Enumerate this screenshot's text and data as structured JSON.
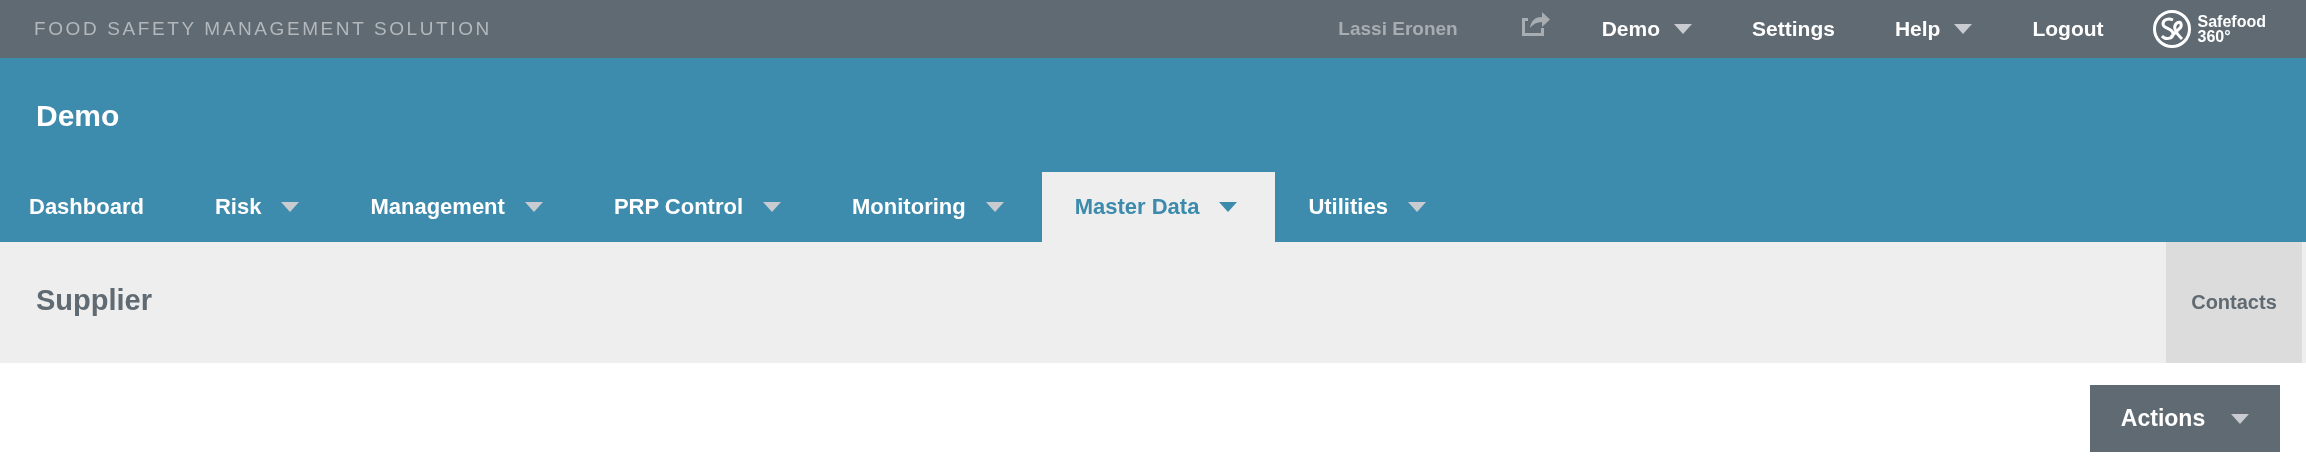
{
  "top_bar": {
    "tagline": "FOOD SAFETY MANAGEMENT SOLUTION",
    "user": "Lassi Eronen",
    "menu": [
      {
        "label": "Demo",
        "dropdown": true
      },
      {
        "label": "Settings",
        "dropdown": false
      },
      {
        "label": "Help",
        "dropdown": true
      },
      {
        "label": "Logout",
        "dropdown": false
      }
    ],
    "logo": {
      "line_1": "Safefood",
      "line_2": "360°"
    }
  },
  "header": {
    "title": "Demo"
  },
  "nav": [
    {
      "label": "Dashboard",
      "dropdown": false,
      "selected": false
    },
    {
      "label": "Risk",
      "dropdown": true,
      "selected": false
    },
    {
      "label": "Management",
      "dropdown": true,
      "selected": false
    },
    {
      "label": "PRP Control",
      "dropdown": true,
      "selected": false
    },
    {
      "label": "Monitoring",
      "dropdown": true,
      "selected": false
    },
    {
      "label": "Master Data",
      "dropdown": true,
      "selected": true
    },
    {
      "label": "Utilities",
      "dropdown": true,
      "selected": false
    }
  ],
  "page": {
    "title": "Supplier",
    "side_tab": "Contacts",
    "actions_button": "Actions"
  }
}
